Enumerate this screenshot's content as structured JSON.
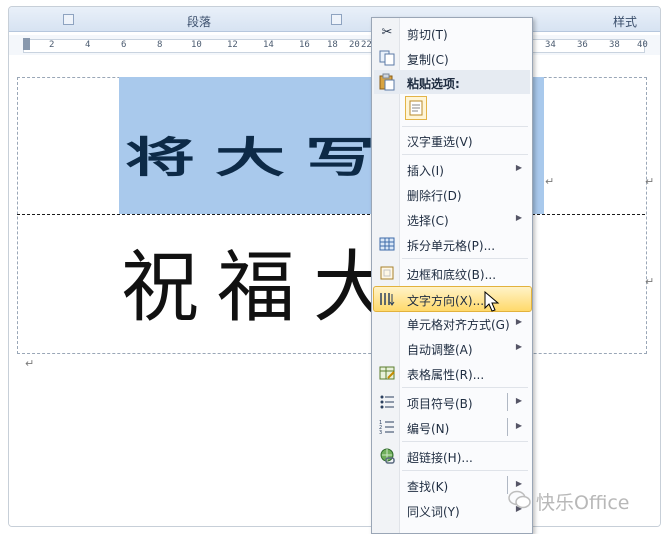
{
  "ribbon": {
    "group_paragraph": "段落",
    "group_styles": "样式"
  },
  "ruler": {
    "numbers": [
      "2",
      "4",
      "6",
      "8",
      "10",
      "12",
      "14",
      "16",
      "18",
      "20",
      "22",
      "34",
      "36",
      "38",
      "40"
    ]
  },
  "document": {
    "selected_text_vertical": "将大写",
    "row2_text": "祝福大"
  },
  "context_menu": {
    "cut": "剪切(T)",
    "copy": "复制(C)",
    "paste_options": "粘贴选项:",
    "reconvert": "汉字重选(V)",
    "insert": "插入(I)",
    "delete_row": "删除行(D)",
    "select": "选择(C)",
    "split_cells": "拆分单元格(P)...",
    "borders_shading": "边框和底纹(B)...",
    "text_direction": "文字方向(X)...",
    "cell_alignment": "单元格对齐方式(G)",
    "autofit": "自动调整(A)",
    "table_properties": "表格属性(R)...",
    "bullets": "项目符号(B)",
    "numbering": "编号(N)",
    "hyperlink": "超链接(H)...",
    "lookup": "查找(K)",
    "synonyms": "同义词(Y)"
  },
  "icons": {
    "cut": "scissors-icon",
    "copy": "copy-icon",
    "paste": "clipboard-icon",
    "split_cells": "table-grid-icon",
    "borders": "border-icon",
    "text_direction": "text-direction-icon",
    "table_properties": "table-properties-icon",
    "bullets": "bulleted-list-icon",
    "numbering": "numbered-list-icon",
    "hyperlink": "globe-link-icon"
  },
  "colors": {
    "selection": "#a9c9ec",
    "menu_highlight": "#ffd96b"
  },
  "watermark": {
    "text": "快乐Office"
  }
}
